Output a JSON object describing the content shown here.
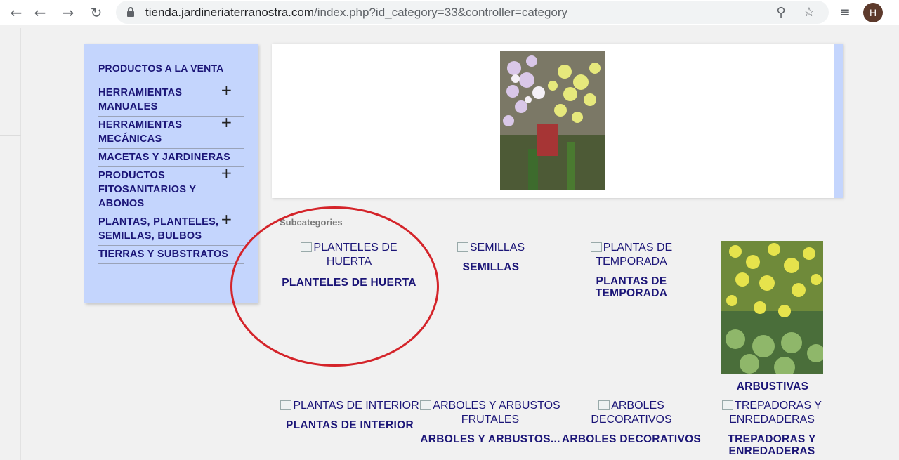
{
  "browser": {
    "url_host": "tienda.jardineriaterranostra.com",
    "url_path": "/index.php?id_category=33&controller=category",
    "avatar_letter": "H"
  },
  "sidebar": {
    "title": "PRODUCTOS A LA VENTA",
    "items": [
      {
        "label": "HERRAMIENTAS MANUALES",
        "expandable": true
      },
      {
        "label": "HERRAMIENTAS MECÁNICAS",
        "expandable": true
      },
      {
        "label": "MACETAS Y JARDINERAS",
        "expandable": false
      },
      {
        "label": "PRODUCTOS FITOSANITARIOS Y ABONOS",
        "expandable": true
      },
      {
        "label": "PLANTAS, PLANTELES, SEMILLAS, BULBOS",
        "expandable": true
      },
      {
        "label": "TIERRAS Y SUBSTRATOS",
        "expandable": false
      }
    ],
    "plus_glyph": "+"
  },
  "main": {
    "subcategories_title": "Subcategories",
    "subcategories": [
      {
        "alt": "PLANTELES DE HUERTA",
        "name": "PLANTELES DE HUERTA"
      },
      {
        "alt": "SEMILLAS",
        "name": "SEMILLAS"
      },
      {
        "alt": "PLANTAS DE TEMPORADA",
        "name": "PLANTAS DE TEMPORADA"
      },
      {
        "alt": "",
        "name": "ARBUSTIVAS"
      },
      {
        "alt": "PLANTAS DE INTERIOR",
        "name": "PLANTAS DE INTERIOR"
      },
      {
        "alt": "ARBOLES Y ARBUSTOS FRUTALES",
        "name": "ARBOLES Y ARBUSTOS..."
      },
      {
        "alt": "ARBOLES DECORATIVOS",
        "name": "ARBOLES DECORATIVOS"
      },
      {
        "alt": "TREPADORAS Y ENREDADERAS",
        "name": "TREPADORAS Y ENREDADERAS"
      }
    ]
  },
  "colors": {
    "sidebar_bg": "#c4d5fd",
    "link_navy": "#1b1577",
    "annotation_red": "#d4242a"
  }
}
